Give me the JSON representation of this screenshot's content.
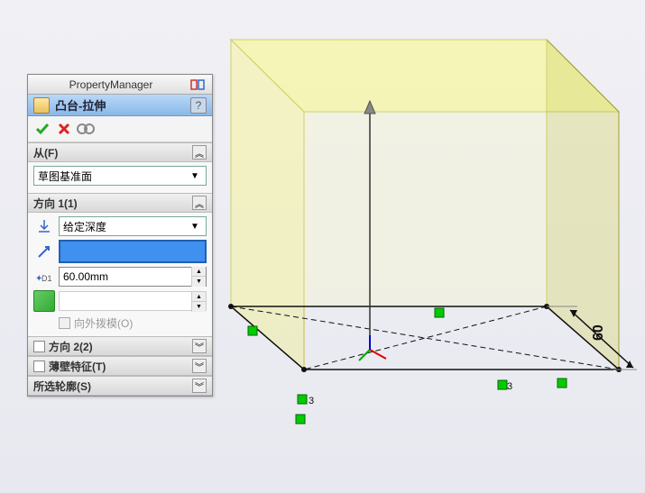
{
  "propertyManager": {
    "title": "PropertyManager",
    "featureName": "凸台-拉伸",
    "helpLabel": "?"
  },
  "sections": {
    "from": {
      "title": "从(F)",
      "option": "草图基准面"
    },
    "direction1": {
      "title": "方向 1(1)",
      "endCondition": "给定深度",
      "depth": "60.00mm",
      "draftOutward": "向外拨模(O)"
    },
    "direction2": {
      "title": "方向 2(2)"
    },
    "thinFeature": {
      "title": "薄壁特征(T)"
    },
    "selectedContours": {
      "title": "所选轮廓(S)"
    }
  },
  "chart_data": {
    "type": "3d-preview",
    "dimensions": {
      "width": 60,
      "depth": 60,
      "height": 60
    },
    "constraint_label": "3",
    "dimension_label": "60"
  }
}
